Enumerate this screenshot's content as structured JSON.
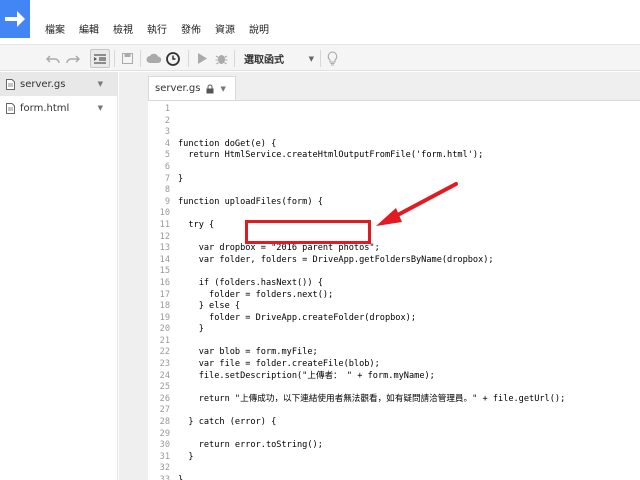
{
  "menu": [
    "檔案",
    "編輯",
    "檢視",
    "執行",
    "發佈",
    "資源",
    "說明"
  ],
  "toolbar": {
    "function_select": "選取函式",
    "icons": [
      "undo-icon",
      "redo-icon",
      "indent-icon",
      "save-icon",
      "cloud-icon",
      "clock-icon",
      "run-icon",
      "debug-icon",
      "lightbulb-icon"
    ]
  },
  "files": [
    {
      "name": "server.gs",
      "active": true
    },
    {
      "name": "form.html",
      "active": false
    }
  ],
  "tab": {
    "label": "server.gs"
  },
  "code_lines": [
    {
      "n": "1",
      "t": ""
    },
    {
      "n": "2",
      "t": ""
    },
    {
      "n": "3",
      "t": ""
    },
    {
      "n": "4",
      "t": "function doGet(e) {"
    },
    {
      "n": "5",
      "t": "  return HtmlService.createHtmlOutputFromFile('form.html');"
    },
    {
      "n": "6",
      "t": ""
    },
    {
      "n": "7",
      "t": "}"
    },
    {
      "n": "8",
      "t": ""
    },
    {
      "n": "9",
      "t": "function uploadFiles(form) {"
    },
    {
      "n": "10",
      "t": ""
    },
    {
      "n": "11",
      "t": "  try {"
    },
    {
      "n": "12",
      "t": ""
    },
    {
      "n": "13",
      "t": "    var dropbox = \"2016 parent photos\";"
    },
    {
      "n": "14",
      "t": "    var folder, folders = DriveApp.getFoldersByName(dropbox);"
    },
    {
      "n": "15",
      "t": ""
    },
    {
      "n": "16",
      "t": "    if (folders.hasNext()) {"
    },
    {
      "n": "17",
      "t": "      folder = folders.next();"
    },
    {
      "n": "18",
      "t": "    } else {"
    },
    {
      "n": "19",
      "t": "      folder = DriveApp.createFolder(dropbox);"
    },
    {
      "n": "20",
      "t": "    }"
    },
    {
      "n": "21",
      "t": ""
    },
    {
      "n": "22",
      "t": "    var blob = form.myFile;"
    },
    {
      "n": "23",
      "t": "    var file = folder.createFile(blob);"
    },
    {
      "n": "24",
      "t": "    file.setDescription(\"上傳者： \" + form.myName);"
    },
    {
      "n": "25",
      "t": ""
    },
    {
      "n": "26",
      "t": "    return \"上傳成功，以下連結使用者無法觀看，如有疑問請洽管理員。\" + file.getUrl();"
    },
    {
      "n": "27",
      "t": ""
    },
    {
      "n": "28",
      "t": "  } catch (error) {"
    },
    {
      "n": "29",
      "t": ""
    },
    {
      "n": "30",
      "t": "    return error.toString();"
    },
    {
      "n": "31",
      "t": "  }"
    },
    {
      "n": "32",
      "t": ""
    },
    {
      "n": "33",
      "t": "}"
    }
  ],
  "colors": {
    "accent": "#4285f4",
    "annotation": "#e01b22"
  }
}
